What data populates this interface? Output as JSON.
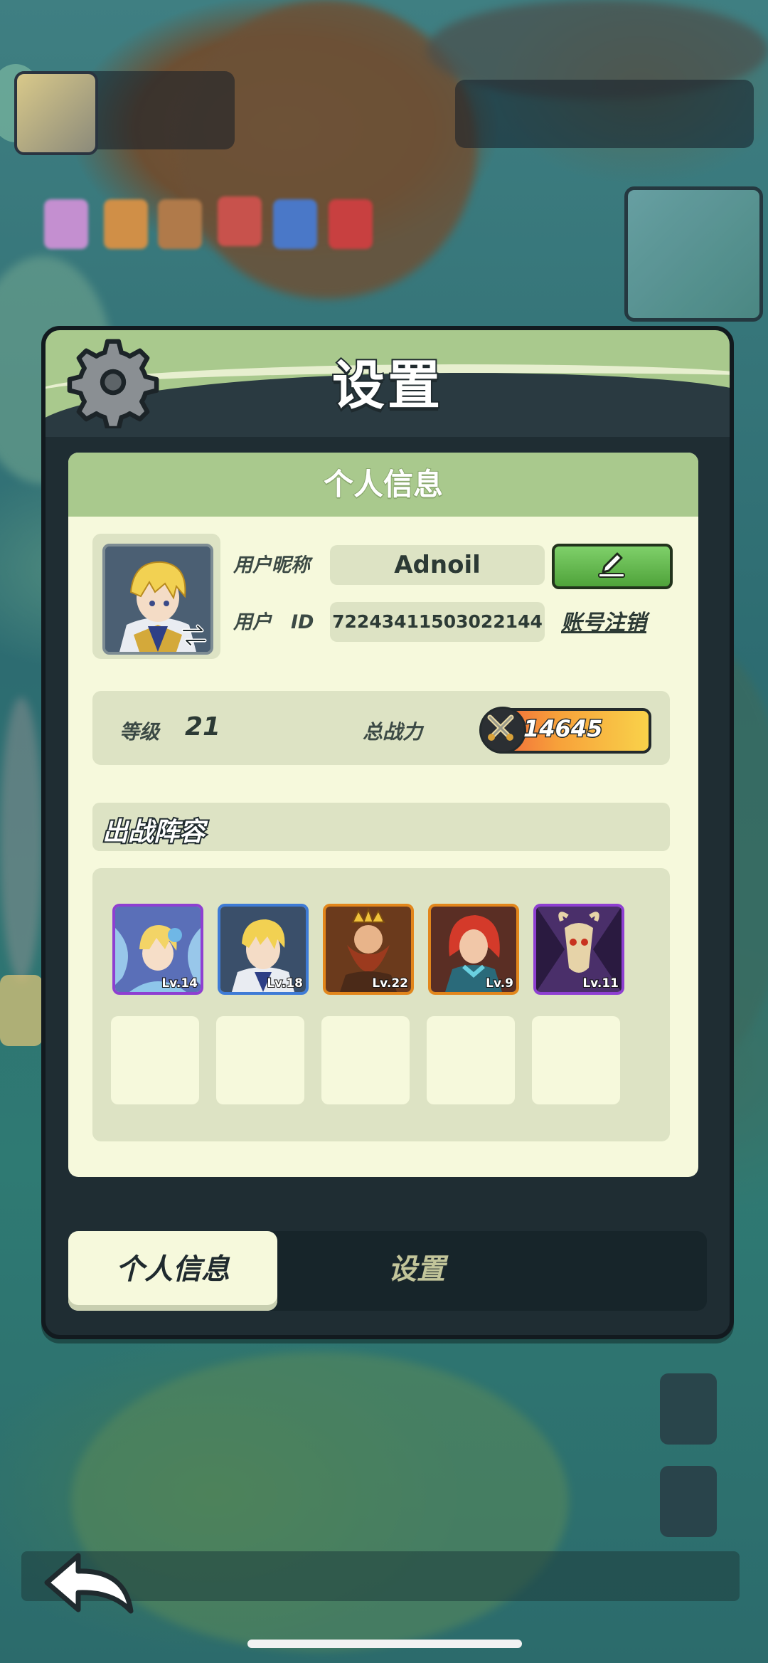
{
  "screen": {
    "title": "设置"
  },
  "card": {
    "header": "个人信息",
    "nickname_label": "用户昵称",
    "nickname_value": "Adnoil",
    "id_label": "用户　ID",
    "id_value": "72243411503022144",
    "cancel_account_link": "账号注销"
  },
  "stats": {
    "level_label": "等级",
    "level_value": "21",
    "power_label": "总战力",
    "power_value": "14645"
  },
  "lineup": {
    "title": "出战阵容",
    "heroes": [
      {
        "level": "Lv.14",
        "frame": "#8e3fd1",
        "icon": "fairy-hero-portrait"
      },
      {
        "level": "Lv.18",
        "frame": "#3e7bd6",
        "icon": "blonde-knight-hero-portrait"
      },
      {
        "level": "Lv.22",
        "frame": "#e2861b",
        "icon": "dwarf-king-hero-portrait"
      },
      {
        "level": "Lv.9",
        "frame": "#e2861b",
        "icon": "red-hair-heroine-portrait"
      },
      {
        "level": "Lv.11",
        "frame": "#8e3fd1",
        "icon": "goat-demon-hero-portrait"
      }
    ],
    "empty_slots": 5
  },
  "tabs": {
    "active": "个人信息",
    "inactive": "设置"
  },
  "icons": {
    "gear": "gear-icon",
    "edit": "pencil-icon",
    "swap": "swap-arrows-icon",
    "power": "crossed-swords-icon",
    "back": "back-arrow-icon"
  }
}
